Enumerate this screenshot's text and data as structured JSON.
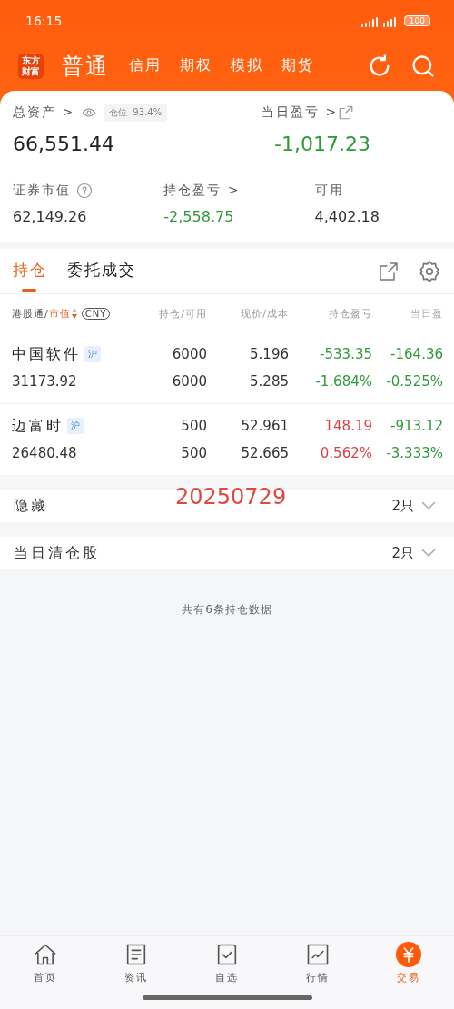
{
  "status_bar": {
    "time": "16:15",
    "battery": "100"
  },
  "header": {
    "logo": "东方财富",
    "tabs": [
      {
        "label": "普通",
        "selected": true
      },
      {
        "label": "信用",
        "selected": false
      },
      {
        "label": "期权",
        "selected": false
      },
      {
        "label": "模拟",
        "selected": false
      },
      {
        "label": "期货",
        "selected": false
      }
    ]
  },
  "summary": {
    "total_assets_label": "总资产 >",
    "position_label": "仓位",
    "position_value": "93.4%",
    "total_assets": "66,551.44",
    "daily_pl_label": "当日盈亏 >",
    "daily_pl": "-1,017.23",
    "stats": [
      {
        "label": "证券市值",
        "value": "62,149.26",
        "kind": "help",
        "color": "#333333"
      },
      {
        "label": "持仓盈亏 >",
        "value": "-2,558.75",
        "kind": "plain",
        "color": "#2e9a3a"
      },
      {
        "label": "可用",
        "value": "4,402.18",
        "kind": "plain",
        "color": "#333333"
      }
    ]
  },
  "holdings": {
    "tabs": [
      {
        "label": "持仓",
        "selected": true
      },
      {
        "label": "委托成交",
        "selected": false
      }
    ],
    "columns": {
      "name_prefix": "港股通/",
      "name_sort": "市值",
      "currency": "CNY",
      "column_2": "持仓/可用",
      "column_3": "现价/成本",
      "column_4": "持仓盈亏",
      "column_5": "当日盈"
    },
    "rows": [
      {
        "name": "中国软件",
        "market": "沪",
        "value": "31173.92",
        "qty": "6000",
        "avail": "6000",
        "price": "5.196",
        "cost": "5.285",
        "pl": {
          "value": "-533.35",
          "pct": "-1.684%",
          "color": "#2e9a3a"
        },
        "day": {
          "value": "-164.36",
          "pct": "-0.525%",
          "color": "#2e9a3a"
        }
      },
      {
        "name": "迈富时",
        "market": "沪",
        "value": "26480.48",
        "qty": "500",
        "avail": "500",
        "price": "52.961",
        "cost": "52.665",
        "pl": {
          "value": "148.19",
          "pct": "0.562%",
          "color": "#d9434a"
        },
        "day": {
          "value": "-913.12",
          "pct": "-3.333%",
          "color": "#2e9a3a"
        }
      }
    ]
  },
  "groups": [
    {
      "label": "隐藏",
      "note": "20250729",
      "count": "2只",
      "expanded": false
    },
    {
      "label": "当日清仓股",
      "count": "2只",
      "expanded": false
    }
  ],
  "footer_note": "共有6条持仓数据",
  "bottom_nav": [
    {
      "label": "首页",
      "selected": false
    },
    {
      "label": "资讯",
      "selected": false
    },
    {
      "label": "自选",
      "selected": false
    },
    {
      "label": "行情",
      "selected": false
    },
    {
      "label": "交易",
      "selected": true
    }
  ]
}
